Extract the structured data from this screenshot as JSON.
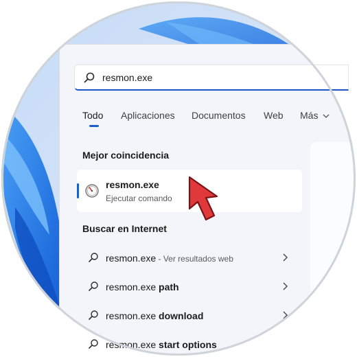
{
  "search": {
    "query": "resmon.exe"
  },
  "tabs": [
    {
      "label": "Todo",
      "active": true
    },
    {
      "label": "Aplicaciones",
      "active": false
    },
    {
      "label": "Documentos",
      "active": false
    },
    {
      "label": "Web",
      "active": false
    },
    {
      "label": "Más",
      "active": false
    }
  ],
  "best_match": {
    "heading": "Mejor coincidencia",
    "title": "resmon.exe",
    "subtitle": "Ejecutar comando",
    "icon": "resource-monitor-gauge-icon"
  },
  "web_search": {
    "heading": "Buscar en Internet",
    "rows": [
      {
        "prefix": "resmon.exe",
        "suffix": "",
        "hint": " - Ver resultados web"
      },
      {
        "prefix": "resmon.exe ",
        "suffix": "path",
        "hint": ""
      },
      {
        "prefix": "resmon.exe ",
        "suffix": "download",
        "hint": ""
      },
      {
        "prefix": "resmon.exe ",
        "suffix": "start options",
        "hint": ""
      }
    ]
  },
  "colors": {
    "accent": "#1a5fc8",
    "pointer": "#e0393b",
    "panel": "#f3f5fa",
    "wallpaper": "#2f7fe6"
  },
  "icons": {
    "search": "search-icon",
    "chevron": "chevron-right-icon",
    "more": "chevron-down-icon",
    "pointer": "red-arrow-pointer-icon"
  }
}
